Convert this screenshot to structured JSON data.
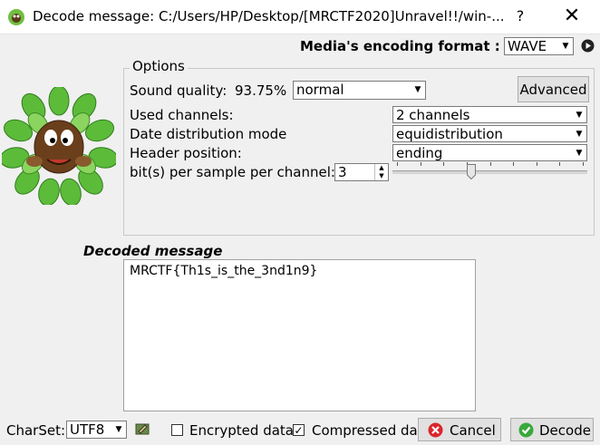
{
  "window": {
    "title": "Decode message: C:/Users/HP/Desktop/[MRCTF2020]Unravel!!/win-...",
    "help_label": "?",
    "close_label": "✕"
  },
  "media": {
    "label": "Media's encoding format :",
    "value": "WAVE"
  },
  "options": {
    "title": "Options",
    "sound_quality_label": "Sound quality:",
    "sound_quality_percent": "93.75%",
    "sound_quality_value": "normal",
    "advanced_label": "Advanced",
    "used_channels_label": "Used channels:",
    "used_channels_value": "2 channels",
    "distribution_label": "Date distribution mode",
    "distribution_value": "equidistribution",
    "header_label": "Header position:",
    "header_value": "ending",
    "bits_label": "bit(s) per sample per channel:",
    "bits_value": "3",
    "bits_slider_fraction": 0.4
  },
  "decoded": {
    "label": "Decoded message",
    "text": "MRCTF{Th1s_is_the_3nd1n9}"
  },
  "footer": {
    "charset_label": "CharSet:",
    "charset_value": "UTF8",
    "encrypted_label": "Encrypted data",
    "encrypted_checked": false,
    "compressed_label": "Compressed dat",
    "compressed_checked": true,
    "cancel_label": "Cancel",
    "decode_label": "Decode"
  },
  "colors": {
    "cancel_icon": "#d9262c",
    "decode_icon": "#3aa83a",
    "leaf": "#5dbb3a"
  },
  "icons": {
    "app": "mascot-icon",
    "play": "play-icon",
    "charset": "pencil-icon",
    "cancel": "cancel-icon",
    "decode": "ok-icon"
  }
}
